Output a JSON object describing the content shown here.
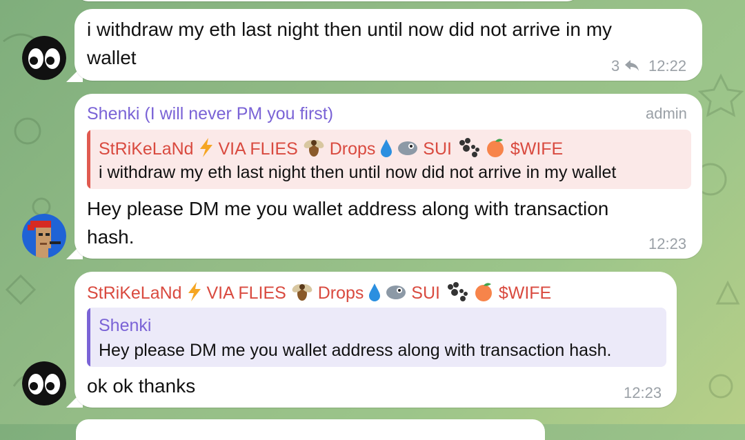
{
  "messages": [
    {
      "text": "i withdraw my eth last night then until now did not arrive in my wallet",
      "line1": "i withdraw my eth last night then until now did not arrive in my",
      "line2": "wallet",
      "reply_count": "3",
      "time": "12:22"
    },
    {
      "sender": "Shenki (I will never PM you first)",
      "role": "admin",
      "quote_sender_parts": [
        "StRiKeLaNd",
        "VIA FLIES",
        "Drops",
        "SUI",
        "$WIFE"
      ],
      "quote_text": "i withdraw my eth last night then until now did not arrive in my wallet",
      "line1": "Hey please DM me you wallet address along with transaction",
      "line2": "hash.",
      "time": "12:23"
    },
    {
      "sender_parts": [
        "StRiKeLaNd",
        "VIA FLIES",
        "Drops",
        "SUI",
        "$WIFE"
      ],
      "quote_sender": "Shenki",
      "quote_text": "Hey please DM me you wallet address along with transaction hash.",
      "text": "ok ok thanks",
      "time": "12:23"
    }
  ],
  "icons": [
    "eyes-avatar-icon",
    "pixel-punk-avatar-icon",
    "reply-arrow-icon",
    "lightning-emoji",
    "fly-emoji",
    "droplet-emoji",
    "sui-emoji",
    "paw-emoji",
    "peach-emoji"
  ],
  "colors": {
    "admin_name": "#7a63d6",
    "user_name": "#d94a3f",
    "quote_red_bg": "#fbe9e8",
    "quote_red_bar": "#e05a50",
    "quote_purple_bg": "#eceaf9",
    "quote_purple_bar": "#7a63d6"
  }
}
